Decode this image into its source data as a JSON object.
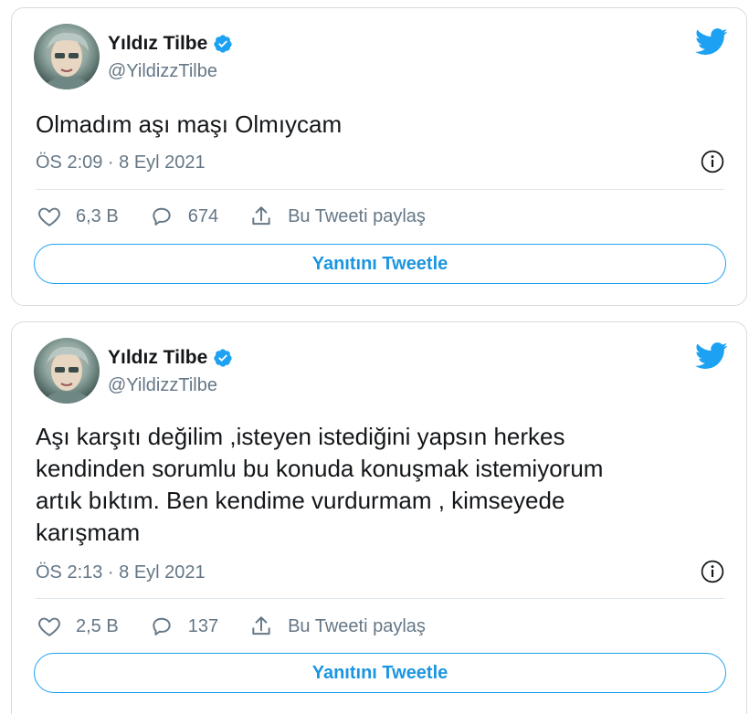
{
  "tweets": [
    {
      "author_name": "Yıldız Tilbe",
      "handle": "@YildizzTilbe",
      "text": "Olmadım aşı maşı Olmıycam",
      "timestamp": "ÖS 2:09 · 8 Eyl 2021",
      "likes": "6,3 B",
      "replies": "674",
      "share_label": "Bu Tweeti paylaş",
      "reply_button": "Yanıtını Tweetle"
    },
    {
      "author_name": "Yıldız Tilbe",
      "handle": "@YildizzTilbe",
      "text": "Aşı karşıtı değilim ,isteyen istediğini yapsın herkes\nkendinden sorumlu bu konuda konuşmak istemiyorum\nartık bıktım. Ben kendime vurdurmam , kimseyede\nkarışmam",
      "timestamp": "ÖS 2:13 · 8 Eyl 2021",
      "likes": "2,5 B",
      "replies": "137",
      "share_label": "Bu Tweeti paylaş",
      "reply_button": "Yanıtını Tweetle"
    }
  ],
  "colors": {
    "accent": "#1da1f2",
    "text": "#14171a",
    "secondary": "#657786",
    "border": "#d6dbdf"
  },
  "icons": [
    "twitter-bird-icon",
    "verified-badge-icon",
    "info-icon",
    "heart-icon",
    "reply-bubble-icon",
    "share-icon"
  ]
}
